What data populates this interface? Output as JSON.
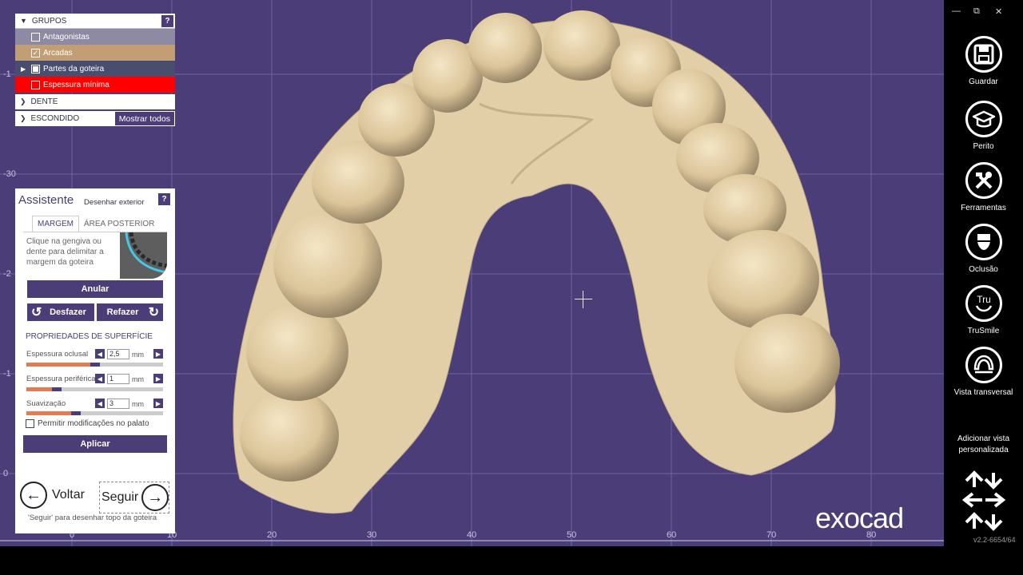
{
  "groups": {
    "title": "GRUPOS",
    "help": "?",
    "items": [
      {
        "label": "Antagonistas",
        "checked": false
      },
      {
        "label": "Arcadas",
        "checked": true
      },
      {
        "label": "Partes da goteira",
        "checked": true
      },
      {
        "label": "Espessura mínima",
        "checked": false
      }
    ],
    "dente": "DENTE",
    "escondido": "ESCONDIDO",
    "show_all": "Mostrar todos"
  },
  "assistant": {
    "title": "Assistente",
    "subtitle": "Desenhar exterior",
    "help": "?",
    "tabs": [
      "MARGEM",
      "ÁREA POSTERIOR"
    ],
    "hint": "Clique na gengiva ou dente para delimitar a margem da goteira",
    "anular": "Anular",
    "desfazer": "Desfazer",
    "refazer": "Refazer",
    "section": "PROPRIEDADES DE SUPERFÍCIE",
    "props": [
      {
        "label": "Espessura oclusal",
        "value": "2,5",
        "unit": "mm",
        "level": 0.5
      },
      {
        "label": "Espessura periférica",
        "value": "1",
        "unit": "mm",
        "level": 0.2
      },
      {
        "label": "Suavização",
        "value": "3",
        "unit": "mm",
        "level": 0.35
      }
    ],
    "palate": "Permitir modificações no palato",
    "apply": "Aplicar",
    "back": "Voltar",
    "next": "Seguir",
    "footer": "'Seguir' para desenhar topo da goteira"
  },
  "sidebar": {
    "items": [
      {
        "label": "Guardar",
        "icon": "save-icon"
      },
      {
        "label": "Perito",
        "icon": "graduation-cap-icon"
      },
      {
        "label": "Ferramentas",
        "icon": "tools-icon"
      },
      {
        "label": "Oclusão",
        "icon": "occlusion-icon"
      },
      {
        "label": "TruSmile",
        "icon": "trusmile-icon"
      },
      {
        "label": "Vista transversal",
        "icon": "cross-section-icon"
      }
    ],
    "custom_view": "Adicionar vista personalizada",
    "version": "v2.2-6654/64"
  },
  "viewport": {
    "watermark": "exocad",
    "x_ticks": [
      "0",
      "10",
      "20",
      "30",
      "40",
      "50",
      "60",
      "70",
      "80"
    ],
    "y_ticks": [
      "-1",
      "-30",
      "-2",
      "-1",
      "0"
    ],
    "colors": {
      "background": "#4b3d78",
      "model": "#e2cfa8",
      "grid": "#7368a3"
    }
  }
}
